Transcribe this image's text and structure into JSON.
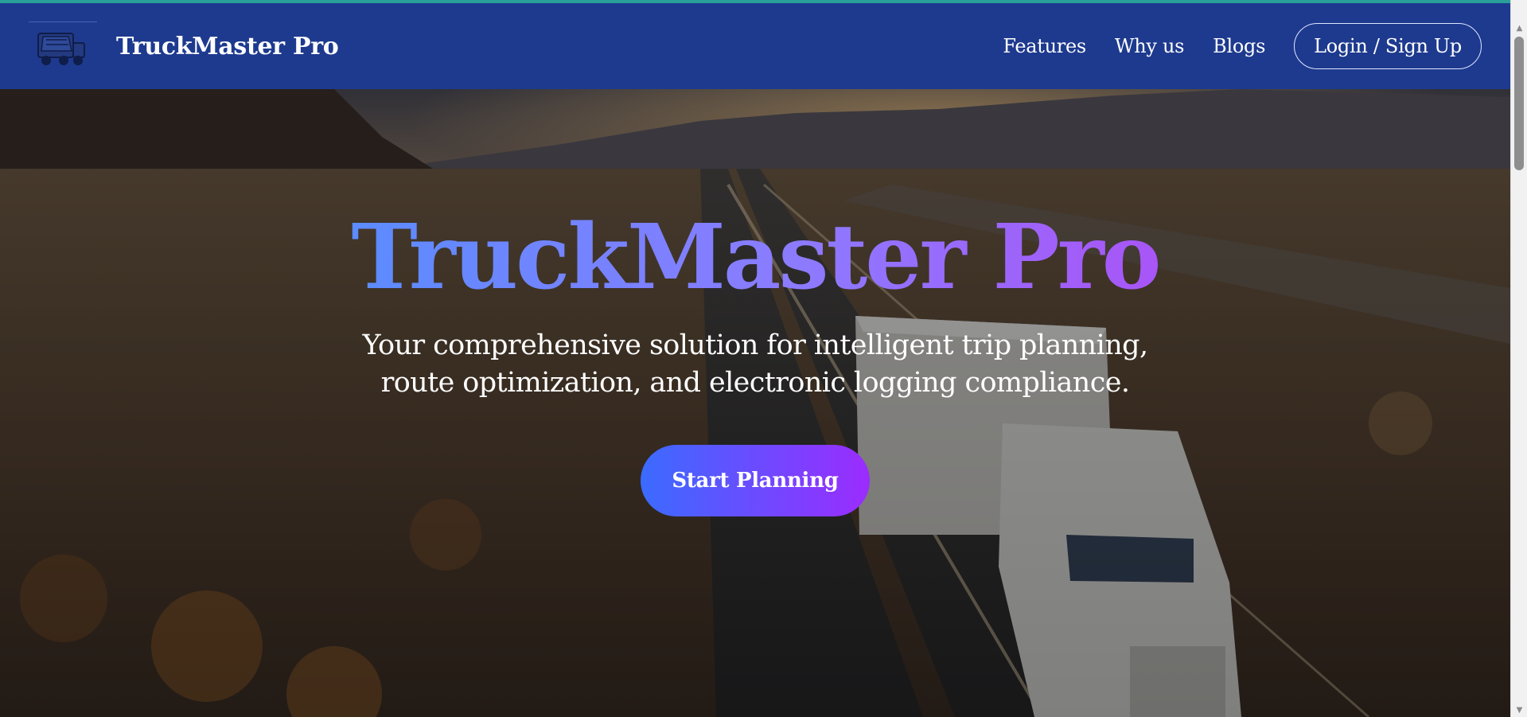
{
  "brand": {
    "name": "TruckMaster Pro",
    "logo_icon": "truck-icon"
  },
  "nav": {
    "links": [
      "Features",
      "Why us",
      "Blogs"
    ],
    "login_label": "Login / Sign Up"
  },
  "hero": {
    "title": "TruckMaster Pro",
    "subtitle_line1": "Your comprehensive solution for intelligent trip planning,",
    "subtitle_line2": "route optimization, and electronic logging compliance.",
    "cta_label": "Start Planning",
    "background": "highway-desert-truck-photo"
  },
  "colors": {
    "navbar": "#1e3a8f",
    "title_gradient_start": "#5b8cff",
    "title_gradient_end": "#a855f7",
    "cta_gradient_start": "#3b6bff",
    "cta_gradient_end": "#9b2cff"
  }
}
